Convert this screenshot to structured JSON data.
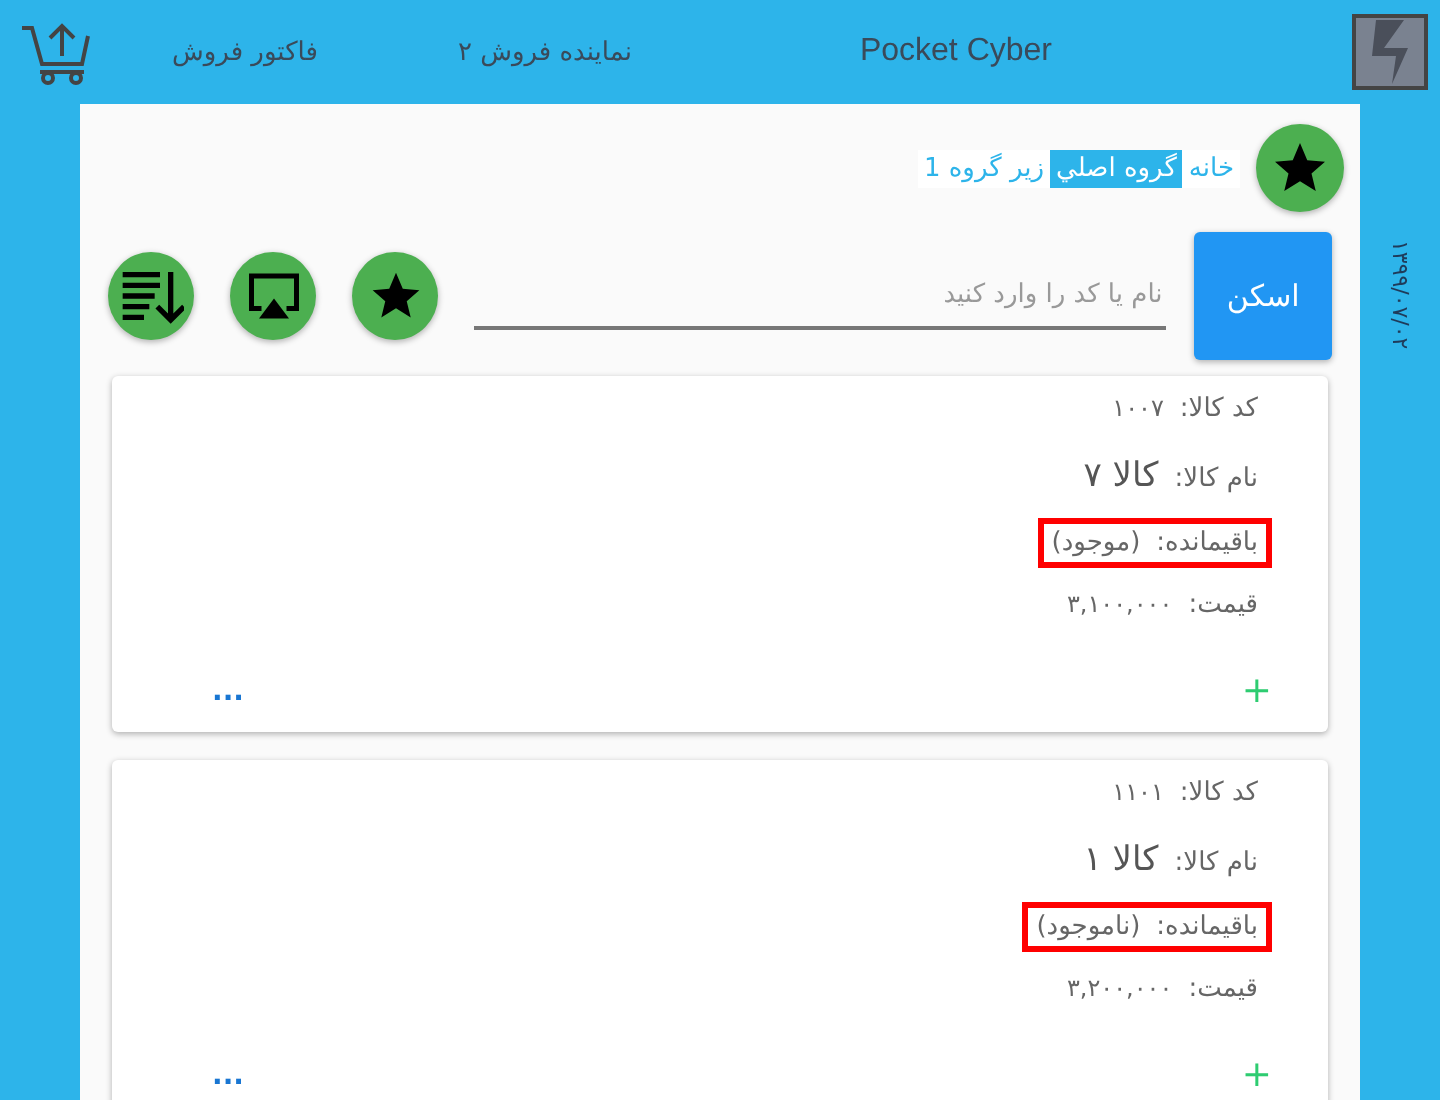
{
  "header": {
    "title": "Pocket Cyber",
    "links": [
      "نماینده فروش ۲",
      "فاکتور فروش"
    ]
  },
  "side_date": "۱۳۹۹/۰۷/۰۲",
  "breadcrumb": [
    {
      "label": "خانه",
      "selected": false
    },
    {
      "label": "گروه اصلي",
      "selected": true
    },
    {
      "label": "زير گروه 1",
      "selected": false
    }
  ],
  "scan_button": "اسکن",
  "search": {
    "placeholder": "نام یا کد را وارد کنید"
  },
  "products": [
    {
      "code_label": "کد کالا:",
      "code": "۱۰۰۷",
      "name_label": "نام کالا:",
      "name": "کالا ۷",
      "stock_label": "باقیمانده:",
      "stock": "(موجود)",
      "price_label": "قیمت:",
      "price": "۳,۱۰۰,۰۰۰",
      "highlighted": true,
      "add": "+",
      "more": "..."
    },
    {
      "code_label": "کد کالا:",
      "code": "۱۱۰۱",
      "name_label": "نام کالا:",
      "name": "کالا ۱",
      "stock_label": "باقیمانده:",
      "stock": "(ناموجود)",
      "price_label": "قیمت:",
      "price": "۳,۲۰۰,۰۰۰",
      "highlighted": true,
      "add": "+",
      "more": "..."
    }
  ]
}
